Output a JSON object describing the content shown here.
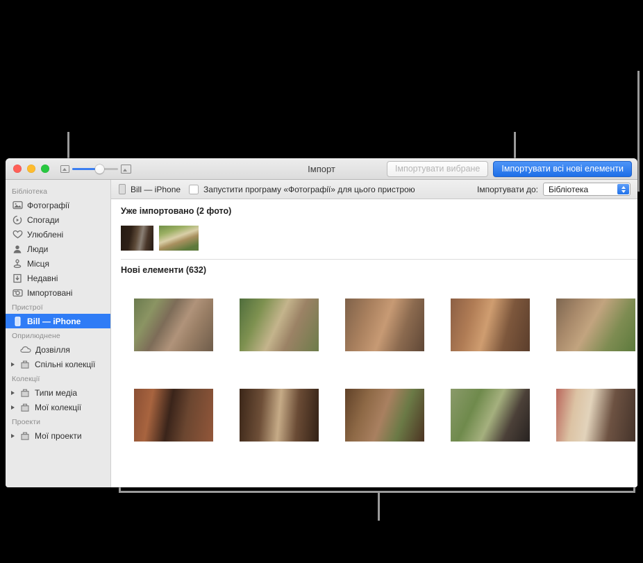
{
  "window": {
    "title": "Імпорт",
    "traffic_lights": [
      "close",
      "minimize",
      "zoom"
    ],
    "zoom_slider": {
      "min_icon": "small-thumbnail-icon",
      "max_icon": "large-thumbnail-icon",
      "value": 50
    },
    "buttons": {
      "import_selected": "Імпортувати вибране",
      "import_all_new": "Імпортувати всі нові елементи"
    }
  },
  "subbar": {
    "device_name": "Bill — iPhone",
    "open_photos_checkbox_label": "Запустити програму «Фотографії» для цього пристрою",
    "checkbox_checked": false,
    "import_to_label": "Імпортувати до:",
    "import_to_value": "Бібліотека"
  },
  "sidebar": {
    "sections": [
      {
        "header": "Бібліотека",
        "items": [
          {
            "label": "Фотографії",
            "icon": "photos-icon",
            "disclosure": false,
            "selected": false
          },
          {
            "label": "Спогади",
            "icon": "memories-icon",
            "disclosure": false,
            "selected": false
          },
          {
            "label": "Улюблені",
            "icon": "heart-icon",
            "disclosure": false,
            "selected": false
          },
          {
            "label": "Люди",
            "icon": "person-icon",
            "disclosure": false,
            "selected": false
          },
          {
            "label": "Місця",
            "icon": "map-pin-icon",
            "disclosure": false,
            "selected": false
          },
          {
            "label": "Недавні",
            "icon": "download-icon",
            "disclosure": false,
            "selected": false
          },
          {
            "label": "Імпортовані",
            "icon": "camera-icon",
            "disclosure": false,
            "selected": false
          }
        ]
      },
      {
        "header": "Пристрої",
        "items": [
          {
            "label": "Bill — iPhone",
            "icon": "iphone-icon",
            "disclosure": false,
            "selected": true
          }
        ]
      },
      {
        "header": "Оприлюднене",
        "items": [
          {
            "label": "Дозвілля",
            "icon": "cloud-icon",
            "disclosure": false,
            "selected": false
          },
          {
            "label": "Спільні колекції",
            "icon": "folder-icon",
            "disclosure": true,
            "selected": false
          }
        ]
      },
      {
        "header": "Колекції",
        "items": [
          {
            "label": "Типи медіа",
            "icon": "folder-icon",
            "disclosure": true,
            "selected": false
          },
          {
            "label": "Мої колекції",
            "icon": "folder-icon",
            "disclosure": true,
            "selected": false
          }
        ]
      },
      {
        "header": "Проекти",
        "items": [
          {
            "label": "Мої проекти",
            "icon": "folder-icon",
            "disclosure": true,
            "selected": false
          }
        ]
      }
    ]
  },
  "content": {
    "already_imported": {
      "title": "Уже імпортовано (2 фото)",
      "thumbnails": [
        {
          "name": "man-at-cafe",
          "colors": [
            "#2a1d16",
            "#6d5442",
            "#8a7b6a"
          ]
        },
        {
          "name": "man-in-garden",
          "colors": [
            "#4a6b3a",
            "#86a05a",
            "#c9b58c"
          ]
        }
      ]
    },
    "new_items": {
      "title": "Нові елементи (632)",
      "photos": [
        {
          "name": "woman-hiker-closeup",
          "colors": [
            "#6e7a55",
            "#b09a7c",
            "#7a6a58"
          ]
        },
        {
          "name": "couple-walking-path",
          "colors": [
            "#5d7a46",
            "#c0ae86",
            "#8d7f66"
          ]
        },
        {
          "name": "group-at-temple-ruins",
          "colors": [
            "#8d6a52",
            "#b98f6d",
            "#6d5440"
          ]
        },
        {
          "name": "friends-sitting-brick-wall",
          "colors": [
            "#9a6a4d",
            "#c08f63",
            "#6a4a34"
          ]
        },
        {
          "name": "woman-walking-ruins",
          "colors": [
            "#8e7055",
            "#b59570",
            "#5d7a3e"
          ]
        },
        {
          "name": "woman-in-archway",
          "colors": [
            "#7d4a33",
            "#a9673f",
            "#3a2318"
          ]
        },
        {
          "name": "two-hikers-in-corridor",
          "colors": [
            "#3a2418",
            "#8a6a4c",
            "#c4a882"
          ]
        },
        {
          "name": "hiker-by-carved-stone",
          "colors": [
            "#6b4630",
            "#9c7450",
            "#4a3020"
          ]
        },
        {
          "name": "friends-resting-on-grass",
          "colors": [
            "#5f7a44",
            "#9aa878",
            "#2c2420"
          ]
        },
        {
          "name": "two-women-on-bus",
          "colors": [
            "#b4635a",
            "#d8c0a4",
            "#5a4438"
          ]
        }
      ]
    }
  },
  "colors": {
    "accent_blue": "#2f7cf6",
    "primary_button": "#2273ea",
    "sidebar_bg": "#e9e9e9",
    "callout_line": "#9a9a9a"
  }
}
